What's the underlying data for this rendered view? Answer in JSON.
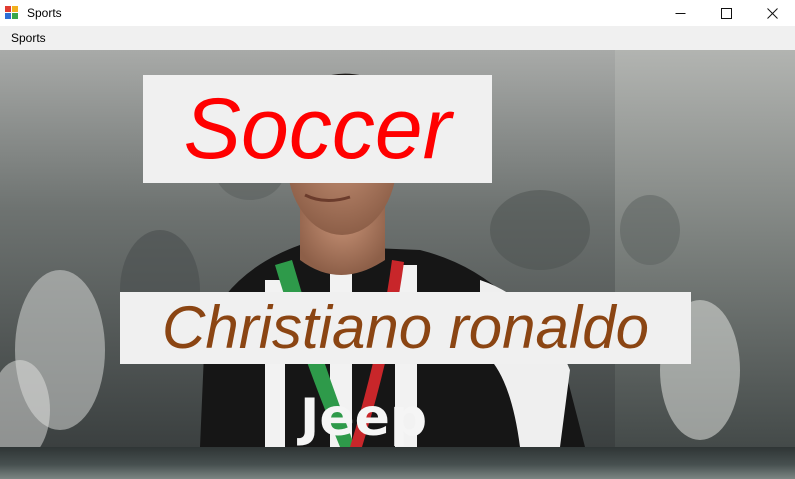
{
  "window": {
    "title": "Sports",
    "controls": {
      "minimize": "—",
      "maximize": "☐",
      "close": "✕"
    }
  },
  "menu": {
    "items": [
      "Sports"
    ]
  },
  "main": {
    "heading": "Soccer",
    "player_name": "Christiano ronaldo",
    "photo_icon": "soccer-player-photo"
  },
  "colors": {
    "heading": "#ff0000",
    "player_name": "#8b4513",
    "label_background": "#f0f0f0",
    "menubar": "#f0f0f0"
  }
}
